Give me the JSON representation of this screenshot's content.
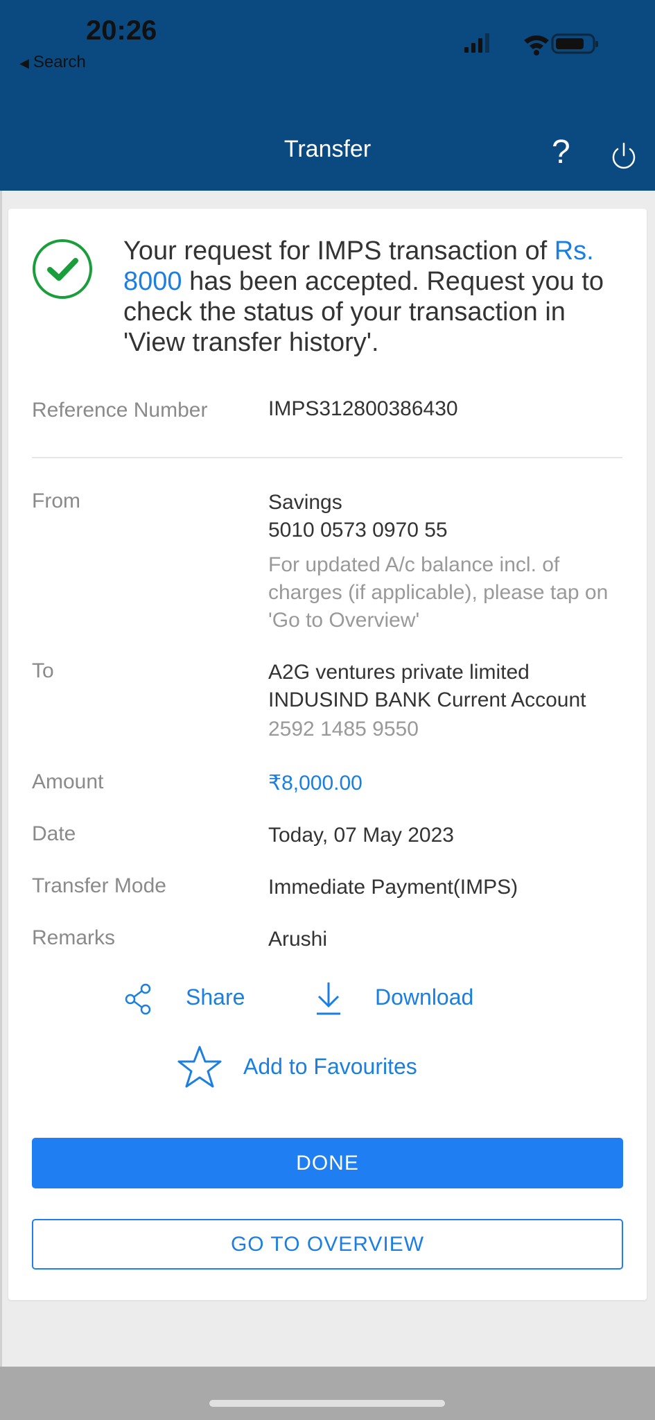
{
  "status_bar": {
    "time": "20:26",
    "back_label": "Search"
  },
  "nav": {
    "title": "Transfer",
    "help_label": "?"
  },
  "message": {
    "part1": "Your request for IMPS transaction of ",
    "amount": "Rs. 8000",
    "part2": " has been accepted. Request you to check the status of your transaction in 'View transfer history'."
  },
  "details": {
    "reference": {
      "label": "Reference Number",
      "value": "IMPS312800386430"
    },
    "from": {
      "label": "From",
      "account_type": "Savings",
      "account_number": "5010 0573 0970 55",
      "note": "For updated A/c balance incl. of charges (if applicable), please tap on 'Go to Overview'"
    },
    "to": {
      "label": "To",
      "name": "A2G ventures private limited",
      "bank": "INDUSIND BANK Current Account",
      "account_number": "2592 1485 9550"
    },
    "amount": {
      "label": "Amount",
      "value": "₹8,000.00"
    },
    "date": {
      "label": "Date",
      "value": "Today, 07 May 2023"
    },
    "mode": {
      "label": "Transfer Mode",
      "value": "Immediate Payment(IMPS)"
    },
    "remarks": {
      "label": "Remarks",
      "value": "Arushi"
    }
  },
  "actions": {
    "share": "Share",
    "download": "Download",
    "favourite": "Add to Favourites"
  },
  "buttons": {
    "done": "DONE",
    "overview": "GO TO OVERVIEW"
  },
  "colors": {
    "header_bg": "#0a4a80",
    "accent": "#1f7ef2",
    "success": "#1a9e3c"
  }
}
